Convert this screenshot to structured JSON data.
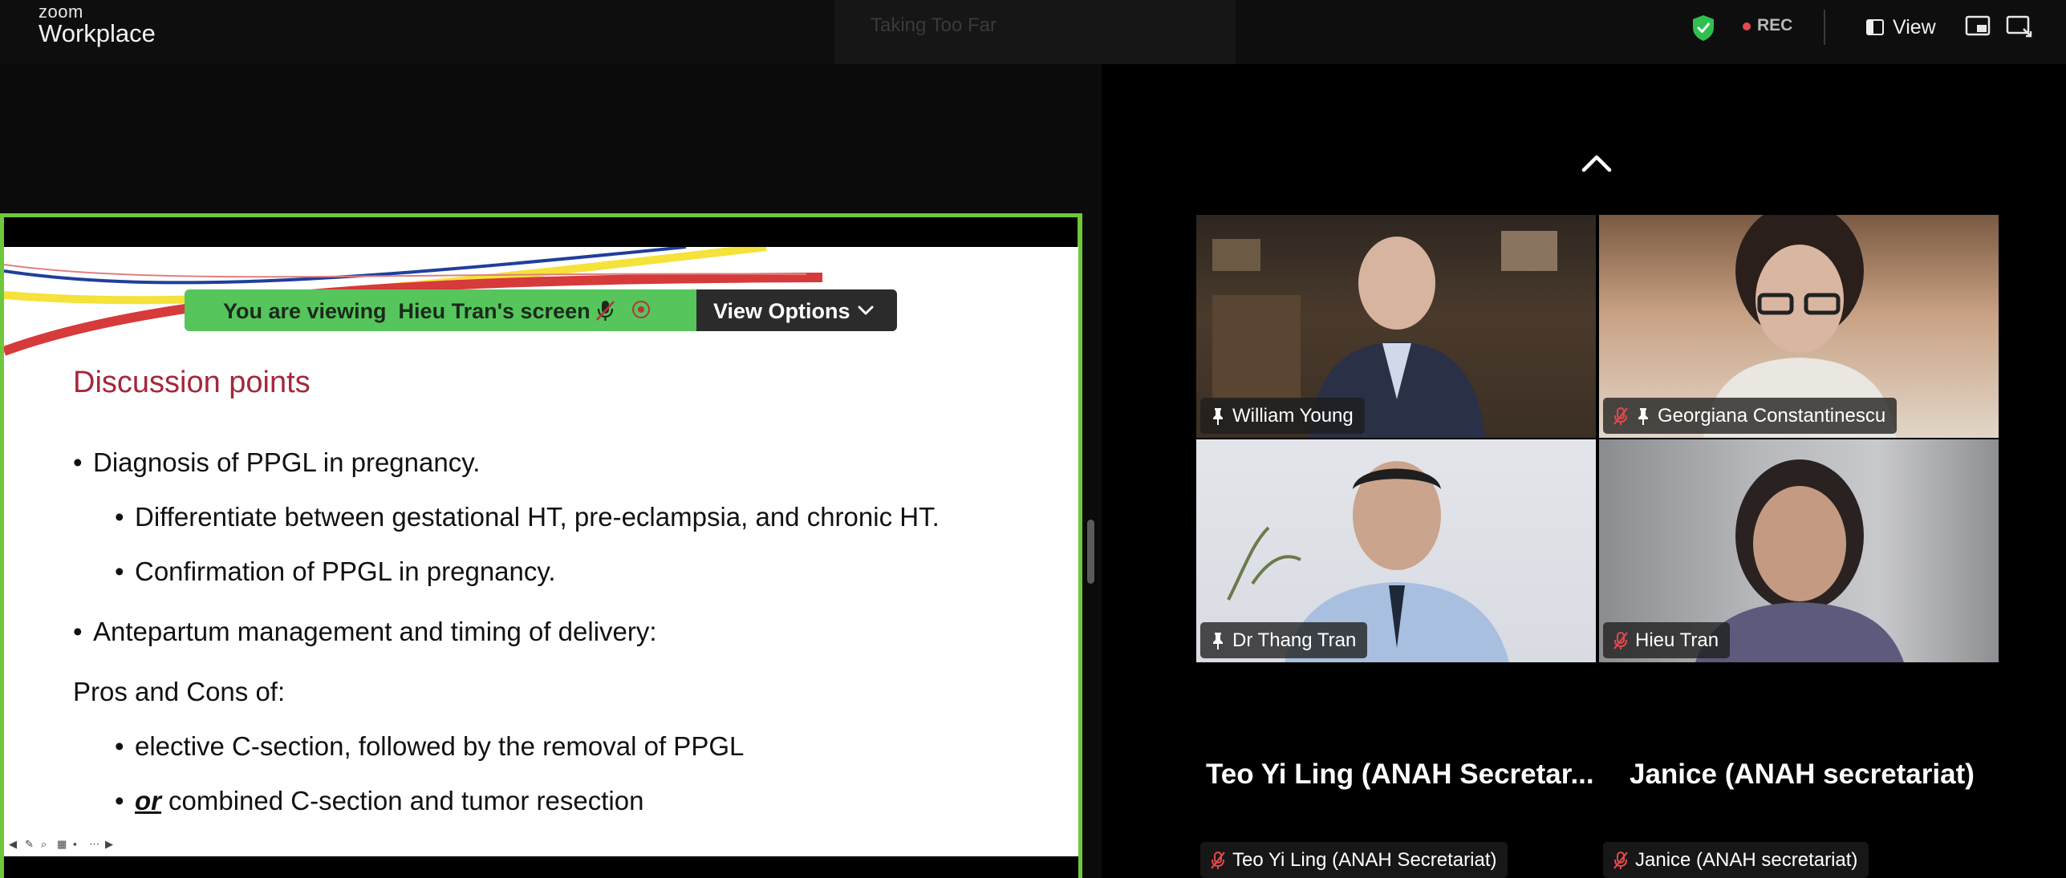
{
  "topbar": {
    "brand_top": "zoom",
    "brand_main": "Workplace",
    "recording_banner": "Taking Too Far",
    "rec_label": "REC",
    "view_label": "View"
  },
  "share": {
    "viewing_text": "You are viewing  Hieu Tran's screen",
    "view_options_label": "View Options"
  },
  "slide": {
    "title": "Discussion points",
    "bullets": [
      "Diagnosis of PPGL in pregnancy.",
      "Differentiate between gestational HT, pre-eclampsia, and chronic HT.",
      "Confirmation of PPGL in pregnancy.",
      "Antepartum management and timing of delivery:",
      "Pros and Cons of:",
      "elective C-section, followed by the removal of PPGL",
      "or",
      "combined C-section and tumor resection"
    ]
  },
  "participants": [
    {
      "name": "William Young",
      "muted": false,
      "pinned": true
    },
    {
      "name": "Georgiana Constantinescu",
      "muted": true,
      "pinned": true
    },
    {
      "name": "Dr Thang Tran",
      "muted": false,
      "pinned": true
    },
    {
      "name": "Hieu Tran",
      "muted": true,
      "pinned": false
    },
    {
      "name": "Teo Yi Ling (ANAH Secretariat)",
      "display": "Teo Yi Ling (ANAH Secretar...",
      "muted": true,
      "pinned": false
    },
    {
      "name": "Janice (ANAH secretariat)",
      "display": "Janice (ANAH secretariat)",
      "muted": true,
      "pinned": false
    }
  ],
  "colors": {
    "share_border": "#6fc83c",
    "slide_title": "#a5273b",
    "banner_green": "#55c55c",
    "rec_red": "#e5484d",
    "shield_green": "#2fbf4f"
  }
}
